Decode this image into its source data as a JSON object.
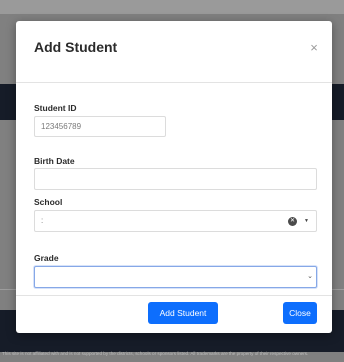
{
  "modal": {
    "title": "Add Student",
    "close_glyph": "×",
    "fields": {
      "student_id": {
        "label": "Student ID",
        "value": "123456789"
      },
      "birth_date": {
        "label": "Birth Date",
        "value": ""
      },
      "school": {
        "label": "School",
        "value": ":",
        "clear_icon": "clear-circle-icon",
        "caret_icon": "caret-down-icon"
      },
      "grade": {
        "label": "Grade",
        "value": "",
        "caret_icon": "chevron-down-icon"
      }
    },
    "buttons": {
      "add": "Add Student",
      "close": "Close"
    }
  },
  "background": {
    "footnote": "This site is not affiliated with and is not supported by the districts, schools or sponsors listed. All trademarks are the property of their respective owners."
  },
  "colors": {
    "primary": "#0d6efd",
    "overlay": "#808080",
    "dark_band": "#161c28",
    "focus_border": "#86a8e7"
  }
}
